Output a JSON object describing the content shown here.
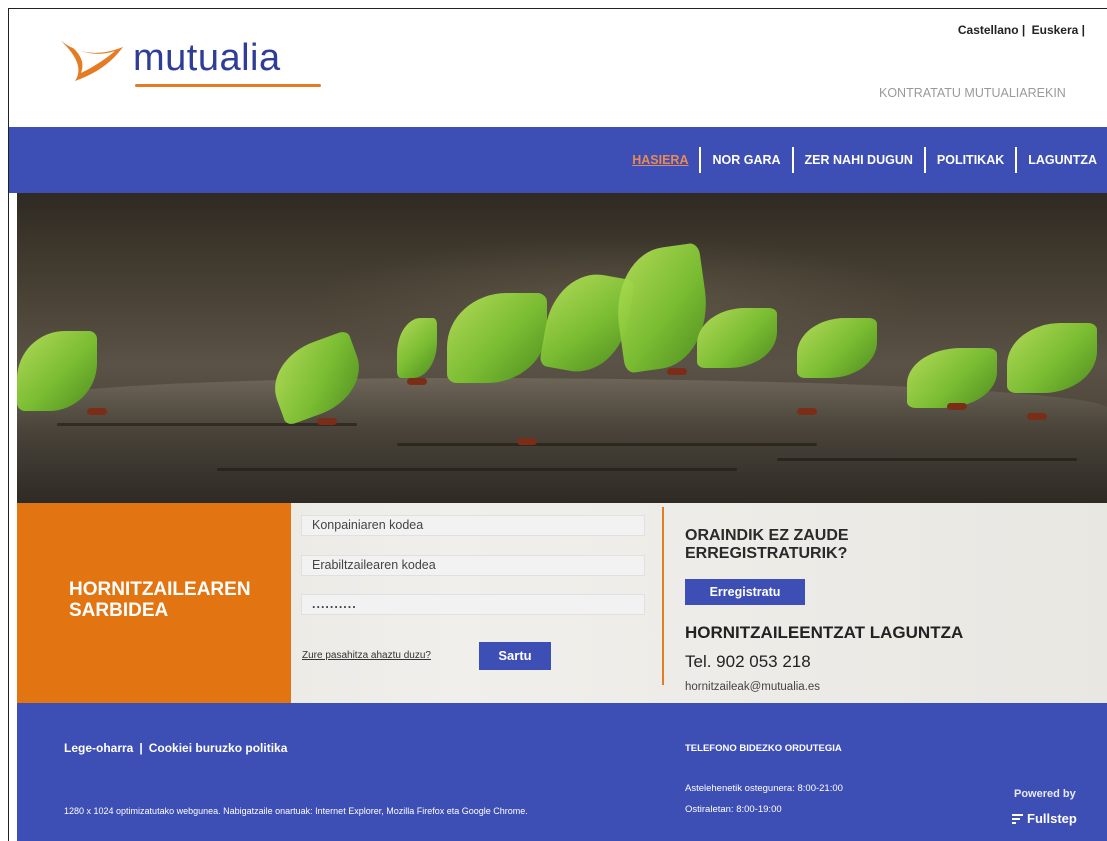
{
  "header": {
    "logo_text": "mutualia",
    "languages": [
      "Castellano |",
      "Euskera |"
    ],
    "contract_link": "KONTRATATU MUTUALIAREKIN"
  },
  "nav": {
    "items": [
      "HASIERA",
      "NOR GARA",
      "ZER NAHI DUGUN",
      "POLITIKAK",
      "LAGUNTZA"
    ],
    "active": "HASIERA"
  },
  "login": {
    "title_line1": "HORNITZAILEAREN",
    "title_line2": "SARBIDEA",
    "company_field": "Konpainiaren kodea",
    "user_field": "Erabiltzailearen kodea",
    "password_field": "..........",
    "forgot_link": "Zure pasahitza ahaztu duzu?",
    "submit_label": "Sartu"
  },
  "register": {
    "title_line1": "ORAINDIK EZ ZAUDE",
    "title_line2": "ERREGISTRATURIK?",
    "button_label": "Erregistratu",
    "help_title": "HORNITZAILEENTZAT LAGUNTZA",
    "phone": "Tel. 902 053 218",
    "email": "hornitzaileak@mutualia.es"
  },
  "footer": {
    "legal_link": "Lege-oharra",
    "cookies_link": "Cookiei buruzko politika",
    "note": "1280 x 1024 optimizatutako webgunea. Nabigatzaile onartuak: Internet Explorer, Mozilla Firefox eta Google Chrome.",
    "hours_title": "TELEFONO BIDEZKO ORDUTEGIA",
    "hours_1": "Astelehenetik ostegunera: 8:00-21:00",
    "hours_2": "Ostiraletan: 8:00-19:00",
    "powered_by": "Powered by",
    "brand": "Fullstep"
  },
  "colors": {
    "brand_blue": "#3d4eb5",
    "brand_orange": "#e37c22",
    "nav_active": "#e88a55"
  }
}
